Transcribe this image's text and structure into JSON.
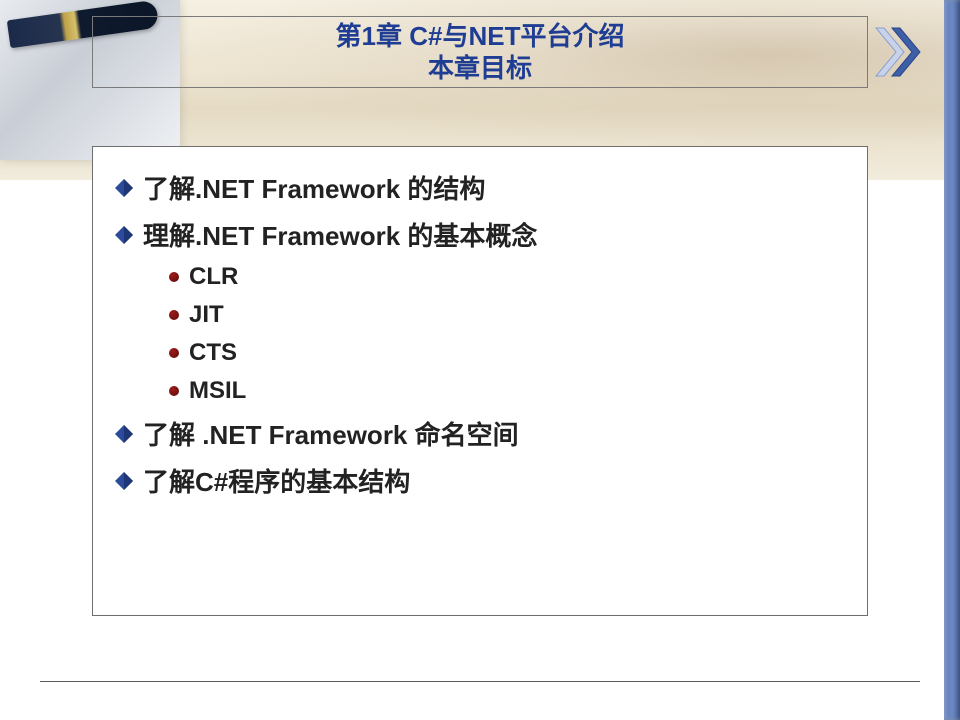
{
  "title": {
    "line1": "第1章  C#与NET平台介绍",
    "line2": "本章目标"
  },
  "colors": {
    "title_text": "#1f3e93",
    "body_text": "#222222",
    "diamond_fill": "#2c4a9a",
    "sub_bullet": "#7a1414",
    "side_bar": "#5a77b6"
  },
  "bullets": [
    {
      "text": "了解.NET Framework 的结构",
      "sub": []
    },
    {
      "text": "理解.NET Framework 的基本概念",
      "sub": [
        "CLR",
        "JIT",
        "CTS",
        "MSIL"
      ]
    },
    {
      "text": "了解 .NET Framework 命名空间",
      "sub": []
    },
    {
      "text": "了解C#程序的基本结构",
      "sub": []
    }
  ]
}
